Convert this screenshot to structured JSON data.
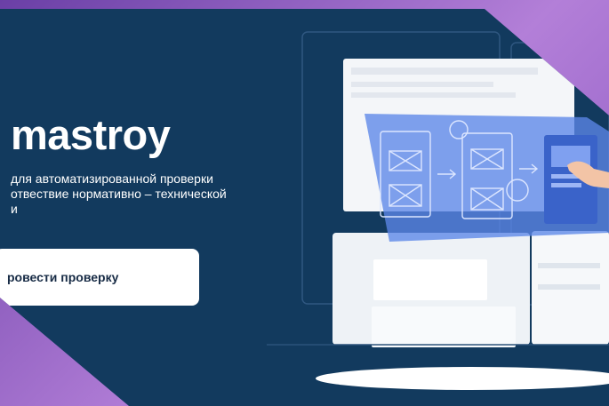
{
  "hero": {
    "brand": "mastroy",
    "description_lines": [
      "для автоматизированной проверки",
      "отвествие нормативно – технической",
      "и"
    ],
    "cta_label": "ровести проверку"
  },
  "colors": {
    "frame_purple": "#9b6fd0",
    "panel_navy": "#123a5e",
    "screen_blue": "#5b86e8",
    "cta_bg": "#ffffff",
    "cta_text": "#172b45"
  },
  "illustration": {
    "description_icons": [
      "computer-monitor",
      "wireframe-screens",
      "cursor-hand",
      "storage-boxes"
    ]
  }
}
